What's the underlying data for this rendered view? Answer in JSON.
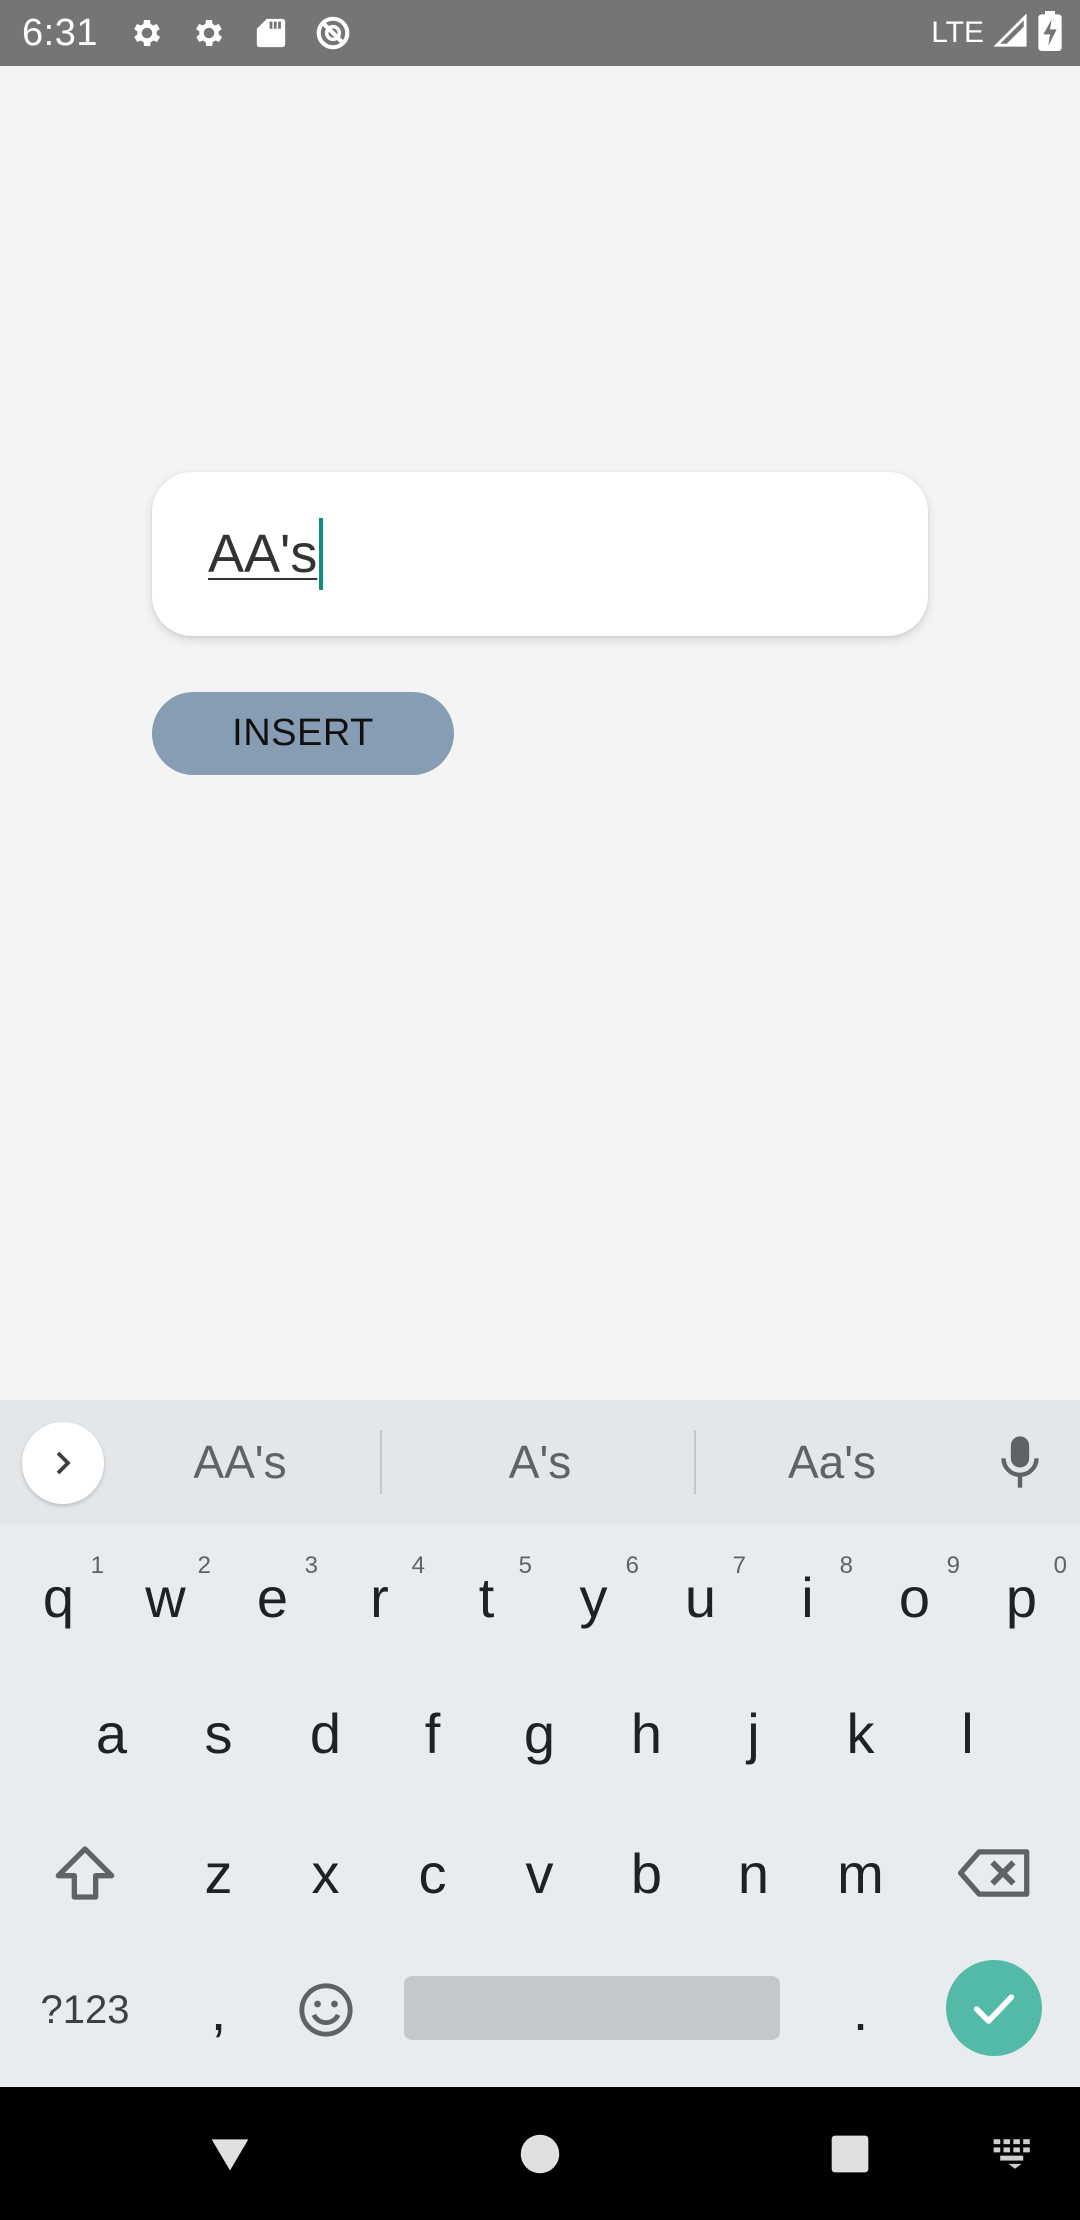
{
  "status_bar": {
    "time": "6:31",
    "network": "LTE",
    "left_icons": [
      "settings-icon",
      "settings-icon",
      "sd-card-icon",
      "data-saver-icon"
    ],
    "right_icons": [
      "signal-icon",
      "battery-charging-icon"
    ]
  },
  "text_field": {
    "value": "AA's"
  },
  "insert_button": {
    "label": "INSERT"
  },
  "keyboard": {
    "suggestions": [
      "AA's",
      "A's",
      "Aa's"
    ],
    "row1": [
      {
        "key": "q",
        "hint": "1"
      },
      {
        "key": "w",
        "hint": "2"
      },
      {
        "key": "e",
        "hint": "3"
      },
      {
        "key": "r",
        "hint": "4"
      },
      {
        "key": "t",
        "hint": "5"
      },
      {
        "key": "y",
        "hint": "6"
      },
      {
        "key": "u",
        "hint": "7"
      },
      {
        "key": "i",
        "hint": "8"
      },
      {
        "key": "o",
        "hint": "9"
      },
      {
        "key": "p",
        "hint": "0"
      }
    ],
    "row2": [
      "a",
      "s",
      "d",
      "f",
      "g",
      "h",
      "j",
      "k",
      "l"
    ],
    "row3": [
      "z",
      "x",
      "c",
      "v",
      "b",
      "n",
      "m"
    ],
    "symbols_label": "?123",
    "comma": ",",
    "period": ".",
    "accent_color": "#52baa6"
  },
  "nav_bar": {
    "items": [
      "back-icon",
      "home-icon",
      "recents-icon",
      "keyboard-switch-icon"
    ]
  }
}
